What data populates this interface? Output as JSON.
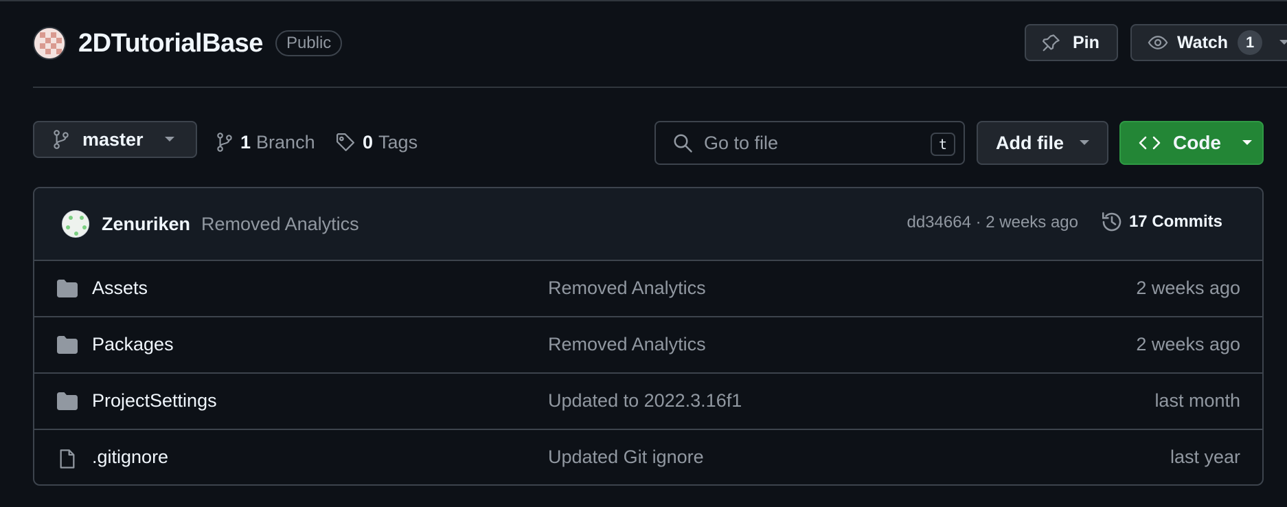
{
  "repo": {
    "name": "2DTutorialBase",
    "visibility": "Public",
    "pin_label": "Pin",
    "watch_label": "Watch",
    "watch_count": "1"
  },
  "toolbar": {
    "branch": "master",
    "branch_count": "1",
    "branch_label": "Branch",
    "tag_count": "0",
    "tag_label": "Tags",
    "search_placeholder": "Go to file",
    "search_shortcut": "t",
    "add_file_label": "Add file",
    "code_label": "Code"
  },
  "latest_commit": {
    "author": "Zenuriken",
    "message": "Removed Analytics",
    "meta": "dd34664 · 2 weeks ago",
    "commits_label": "17 Commits"
  },
  "files": [
    {
      "name": "Assets",
      "type": "folder",
      "message": "Removed Analytics",
      "age": "2 weeks ago"
    },
    {
      "name": "Packages",
      "type": "folder",
      "message": "Removed Analytics",
      "age": "2 weeks ago"
    },
    {
      "name": "ProjectSettings",
      "type": "folder",
      "message": "Updated to 2022.3.16f1",
      "age": "last month"
    },
    {
      "name": ".gitignore",
      "type": "file",
      "message": "Updated Git ignore",
      "age": "last year"
    }
  ],
  "colors": {
    "background": "#0d1117",
    "border": "#3d444d",
    "primary_button": "#238636",
    "muted_text": "#9198a1"
  },
  "icons": {
    "pin": "pin-icon",
    "watch": "eye-icon",
    "branch": "git-branch-icon",
    "tag": "tag-icon",
    "search": "search-icon",
    "code": "code-icon",
    "history": "history-icon",
    "folder": "folder-icon",
    "file": "file-icon"
  }
}
